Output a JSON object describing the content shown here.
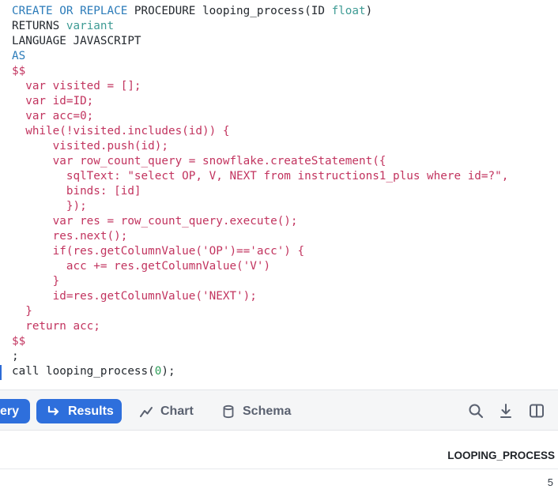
{
  "editor": {
    "lines": [
      [
        {
          "t": "CREATE OR REPLACE",
          "c": "kw"
        },
        {
          "t": " PROCEDURE looping_process(ID ",
          "c": ""
        },
        {
          "t": "float",
          "c": "ty"
        },
        {
          "t": ")",
          "c": ""
        }
      ],
      [
        {
          "t": "RETURNS ",
          "c": ""
        },
        {
          "t": "variant",
          "c": "ty"
        }
      ],
      [
        {
          "t": "LANGUAGE JAVASCRIPT",
          "c": ""
        }
      ],
      [
        {
          "t": "AS",
          "c": "kw"
        }
      ],
      [
        {
          "t": "$$",
          "c": "js"
        }
      ],
      [
        {
          "t": "  var visited = [];",
          "c": "js"
        }
      ],
      [
        {
          "t": "  var id=ID;",
          "c": "js"
        }
      ],
      [
        {
          "t": "  var acc=0;",
          "c": "js"
        }
      ],
      [
        {
          "t": "  while(!visited.includes(id)) {",
          "c": "js"
        }
      ],
      [
        {
          "t": "      visited.push(id);",
          "c": "js"
        }
      ],
      [
        {
          "t": "      var row_count_query = snowflake.createStatement({",
          "c": "js"
        }
      ],
      [
        {
          "t": "        sqlText: \"select OP, V, NEXT from instructions1_plus where id=?\",",
          "c": "js"
        }
      ],
      [
        {
          "t": "        binds: [id]",
          "c": "js"
        }
      ],
      [
        {
          "t": "        });",
          "c": "js"
        }
      ],
      [
        {
          "t": "      var res = row_count_query.execute();",
          "c": "js"
        }
      ],
      [
        {
          "t": "      res.next();",
          "c": "js"
        }
      ],
      [
        {
          "t": "      if(res.getColumnValue('OP')=='acc') {",
          "c": "js"
        }
      ],
      [
        {
          "t": "        acc += res.getColumnValue('V')",
          "c": "js"
        }
      ],
      [
        {
          "t": "      }",
          "c": "js"
        }
      ],
      [
        {
          "t": "      id=res.getColumnValue('NEXT');",
          "c": "js"
        }
      ],
      [
        {
          "t": "  }",
          "c": "js"
        }
      ],
      [
        {
          "t": "  return acc;",
          "c": "js"
        }
      ],
      [
        {
          "t": "$$",
          "c": "js"
        }
      ],
      [
        {
          "t": ";",
          "c": ""
        }
      ],
      [
        {
          "t": "call looping_process(",
          "c": ""
        },
        {
          "t": "0",
          "c": "num"
        },
        {
          "t": ");",
          "c": ""
        }
      ]
    ]
  },
  "toolbar": {
    "query_label": "ery",
    "results_label": "Results",
    "chart_label": "Chart",
    "schema_label": "Schema",
    "icons": [
      "search-icon",
      "download-icon",
      "split-view-icon"
    ]
  },
  "results": {
    "columns": [
      "LOOPING_PROCESS"
    ],
    "rows": [
      [
        "5"
      ]
    ]
  },
  "colors": {
    "accent": "#2e6fdc",
    "keyword": "#2b7bb9",
    "type": "#3e9b94",
    "javascript": "#c2345f",
    "number": "#2e9e59"
  }
}
